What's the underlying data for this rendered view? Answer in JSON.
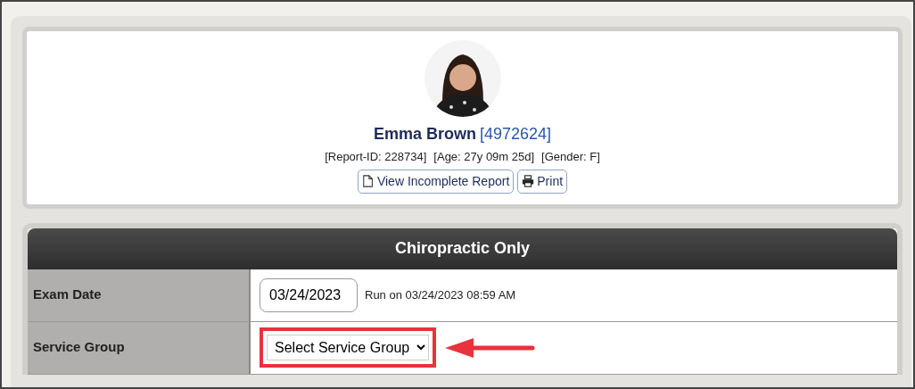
{
  "patient": {
    "name": "Emma Brown",
    "id": "[4972624]",
    "details": [
      "[Report-ID: 228734]",
      "[Age: 27y 09m 25d]",
      "[Gender: F]"
    ],
    "buttons": [
      {
        "label": "View Incomplete Report",
        "kind": "document"
      },
      {
        "label": "Print",
        "kind": "printer"
      }
    ]
  },
  "section": {
    "title": "Chiropractic Only",
    "rows": [
      {
        "kind": "date",
        "label": "Exam Date",
        "value": "03/24/2023",
        "note": "Run on 03/24/2023 08:59 AM"
      },
      {
        "kind": "select",
        "label": "Service Group",
        "value": "Select Service Group",
        "highlighted": true
      }
    ]
  }
}
